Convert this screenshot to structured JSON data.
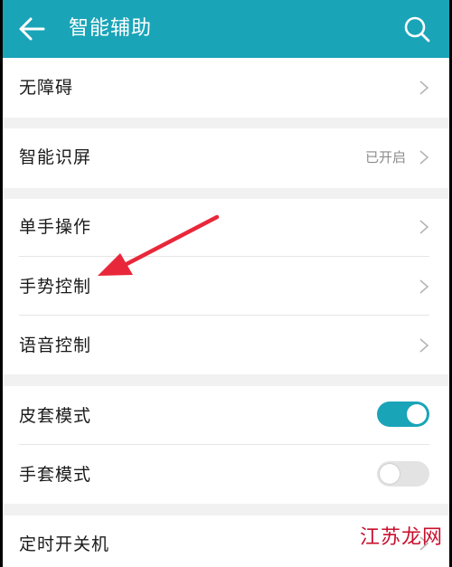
{
  "appbar": {
    "title": "智能辅助",
    "back_icon": "arrow-left-icon",
    "search_icon": "search-icon",
    "background_color": "#1aa4b8"
  },
  "sections": [
    {
      "rows": [
        {
          "label": "无障碍"
        }
      ]
    },
    {
      "rows": [
        {
          "label": "智能识屏",
          "value": "已开启"
        }
      ]
    },
    {
      "rows": [
        {
          "label": "单手操作"
        },
        {
          "label": "手势控制"
        },
        {
          "label": "语音控制"
        }
      ]
    },
    {
      "rows": [
        {
          "label": "皮套模式",
          "toggle": "on"
        },
        {
          "label": "手套模式",
          "toggle": "off"
        }
      ]
    },
    {
      "rows": [
        {
          "label": "定时开关机"
        }
      ]
    }
  ],
  "annotation": {
    "type": "red-arrow",
    "target": "手势控制",
    "color": "#e8283a"
  },
  "watermark": {
    "text": "江苏龙网"
  },
  "colors": {
    "accent": "#1aa4b8",
    "divider_gap": "#f1f1f1",
    "arrow": "#e8283a"
  }
}
